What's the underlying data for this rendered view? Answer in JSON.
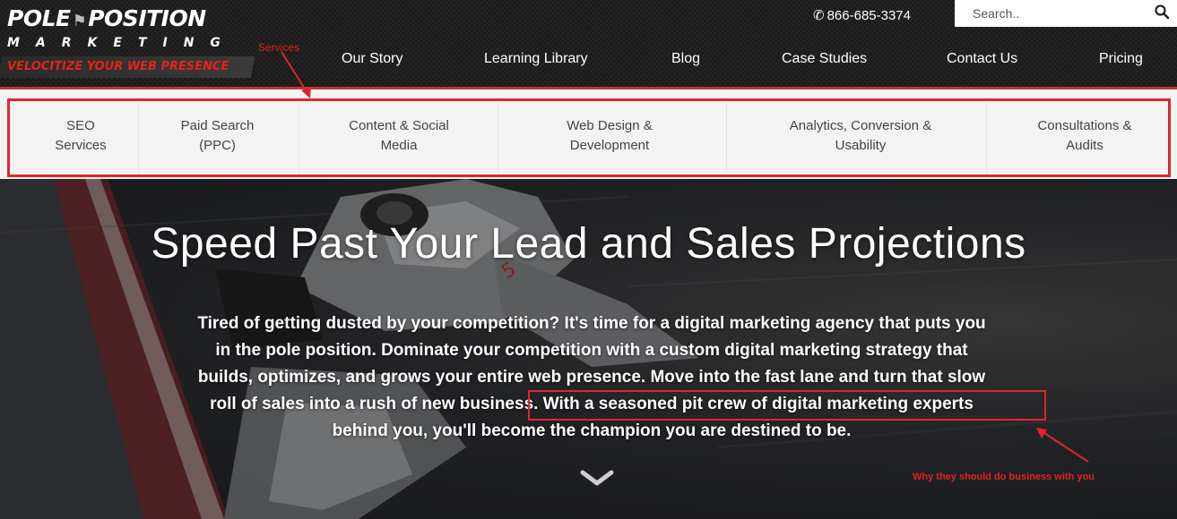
{
  "logo": {
    "line1a": "POLE",
    "line1b": "POSITION",
    "line2": "MARKETING",
    "tagline": "VELOCITIZE YOUR WEB PRESENCE"
  },
  "annotations": {
    "services_label": "Services",
    "why_label": "Why they should do business with you",
    "accent_color": "#e0262b"
  },
  "header": {
    "phone": "866-685-3374",
    "search_placeholder": "Search..",
    "nav": [
      "Our Story",
      "Learning Library",
      "Blog",
      "Case Studies",
      "Contact Us",
      "Pricing"
    ]
  },
  "services": [
    {
      "line1": "SEO",
      "line2": "Services"
    },
    {
      "line1": "Paid Search",
      "line2": "(PPC)"
    },
    {
      "line1": "Content & Social",
      "line2": "Media"
    },
    {
      "line1": "Web Design &",
      "line2": "Development"
    },
    {
      "line1": "Analytics, Conversion &",
      "line2": "Usability"
    },
    {
      "line1": "Consultations &",
      "line2": "Audits"
    }
  ],
  "hero": {
    "title": "Speed Past Your Lead and Sales Projections",
    "body_line1": "Tired of getting dusted by your competition? It's time for a digital marketing agency that puts you",
    "body_line2": "in the pole position. Dominate your competition with a custom digital marketing strategy that",
    "body_line3": "builds, optimizes, and grows your entire web presence. Move into the fast lane and turn that slow",
    "body_line4a": "roll of sales into a rush of new business.",
    "body_line4b": "With a seasoned pit crew of digital marketing experts",
    "body_line5": "behind you, you'll become the champion you are destined to be."
  }
}
